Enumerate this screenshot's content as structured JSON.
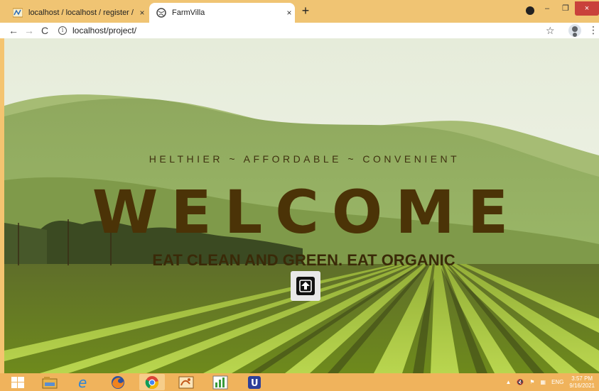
{
  "browser": {
    "tabs": [
      {
        "title": "localhost / localhost / register / ..."
      },
      {
        "title": "FarmVilla"
      }
    ],
    "new_tab": "+",
    "close_tab": "×",
    "url": "localhost/project/",
    "window_controls": {
      "minimize": "–",
      "maximize": "❐",
      "close": "×"
    }
  },
  "page": {
    "tagline": "HELTHIER ~ AFFORDABLE ~ CONVENIENT",
    "heading": "WELCOME",
    "subheading": "EAT CLEAN AND GREEN. EAT ORGANIC"
  },
  "taskbar": {
    "language": "ENG",
    "time": "3:57 PM",
    "date": "9/16/2021"
  },
  "colors": {
    "tab_strip": "#f0c473",
    "taskbar": "#f0b35c",
    "heading": "#4b3307"
  }
}
